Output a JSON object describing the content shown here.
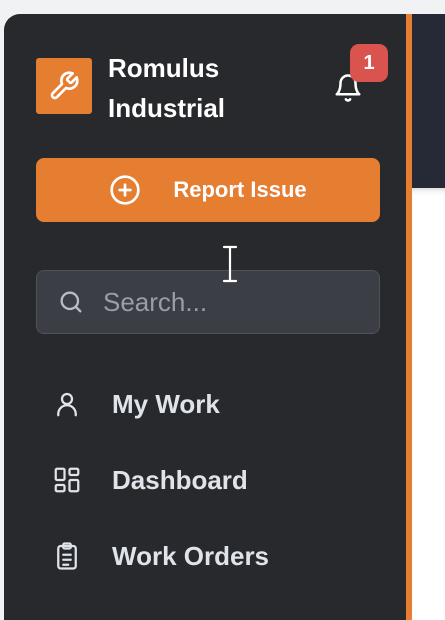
{
  "brand": {
    "name_line1": "Romulus",
    "name_line2": "Industrial",
    "icon": "wrench-icon"
  },
  "notifications": {
    "icon": "bell-icon",
    "count": "1"
  },
  "report_button": {
    "label": "Report Issue",
    "icon": "plus-circle-icon"
  },
  "search": {
    "placeholder": "Search...",
    "value": "",
    "icon": "search-icon"
  },
  "nav": {
    "items": [
      {
        "label": "My Work",
        "icon": "user-icon"
      },
      {
        "label": "Dashboard",
        "icon": "dashboard-icon"
      },
      {
        "label": "Work Orders",
        "icon": "clipboard-icon"
      }
    ]
  },
  "colors": {
    "accent": "#e67e32",
    "sidebar_bg": "#28292d",
    "badge": "#d9534f"
  }
}
